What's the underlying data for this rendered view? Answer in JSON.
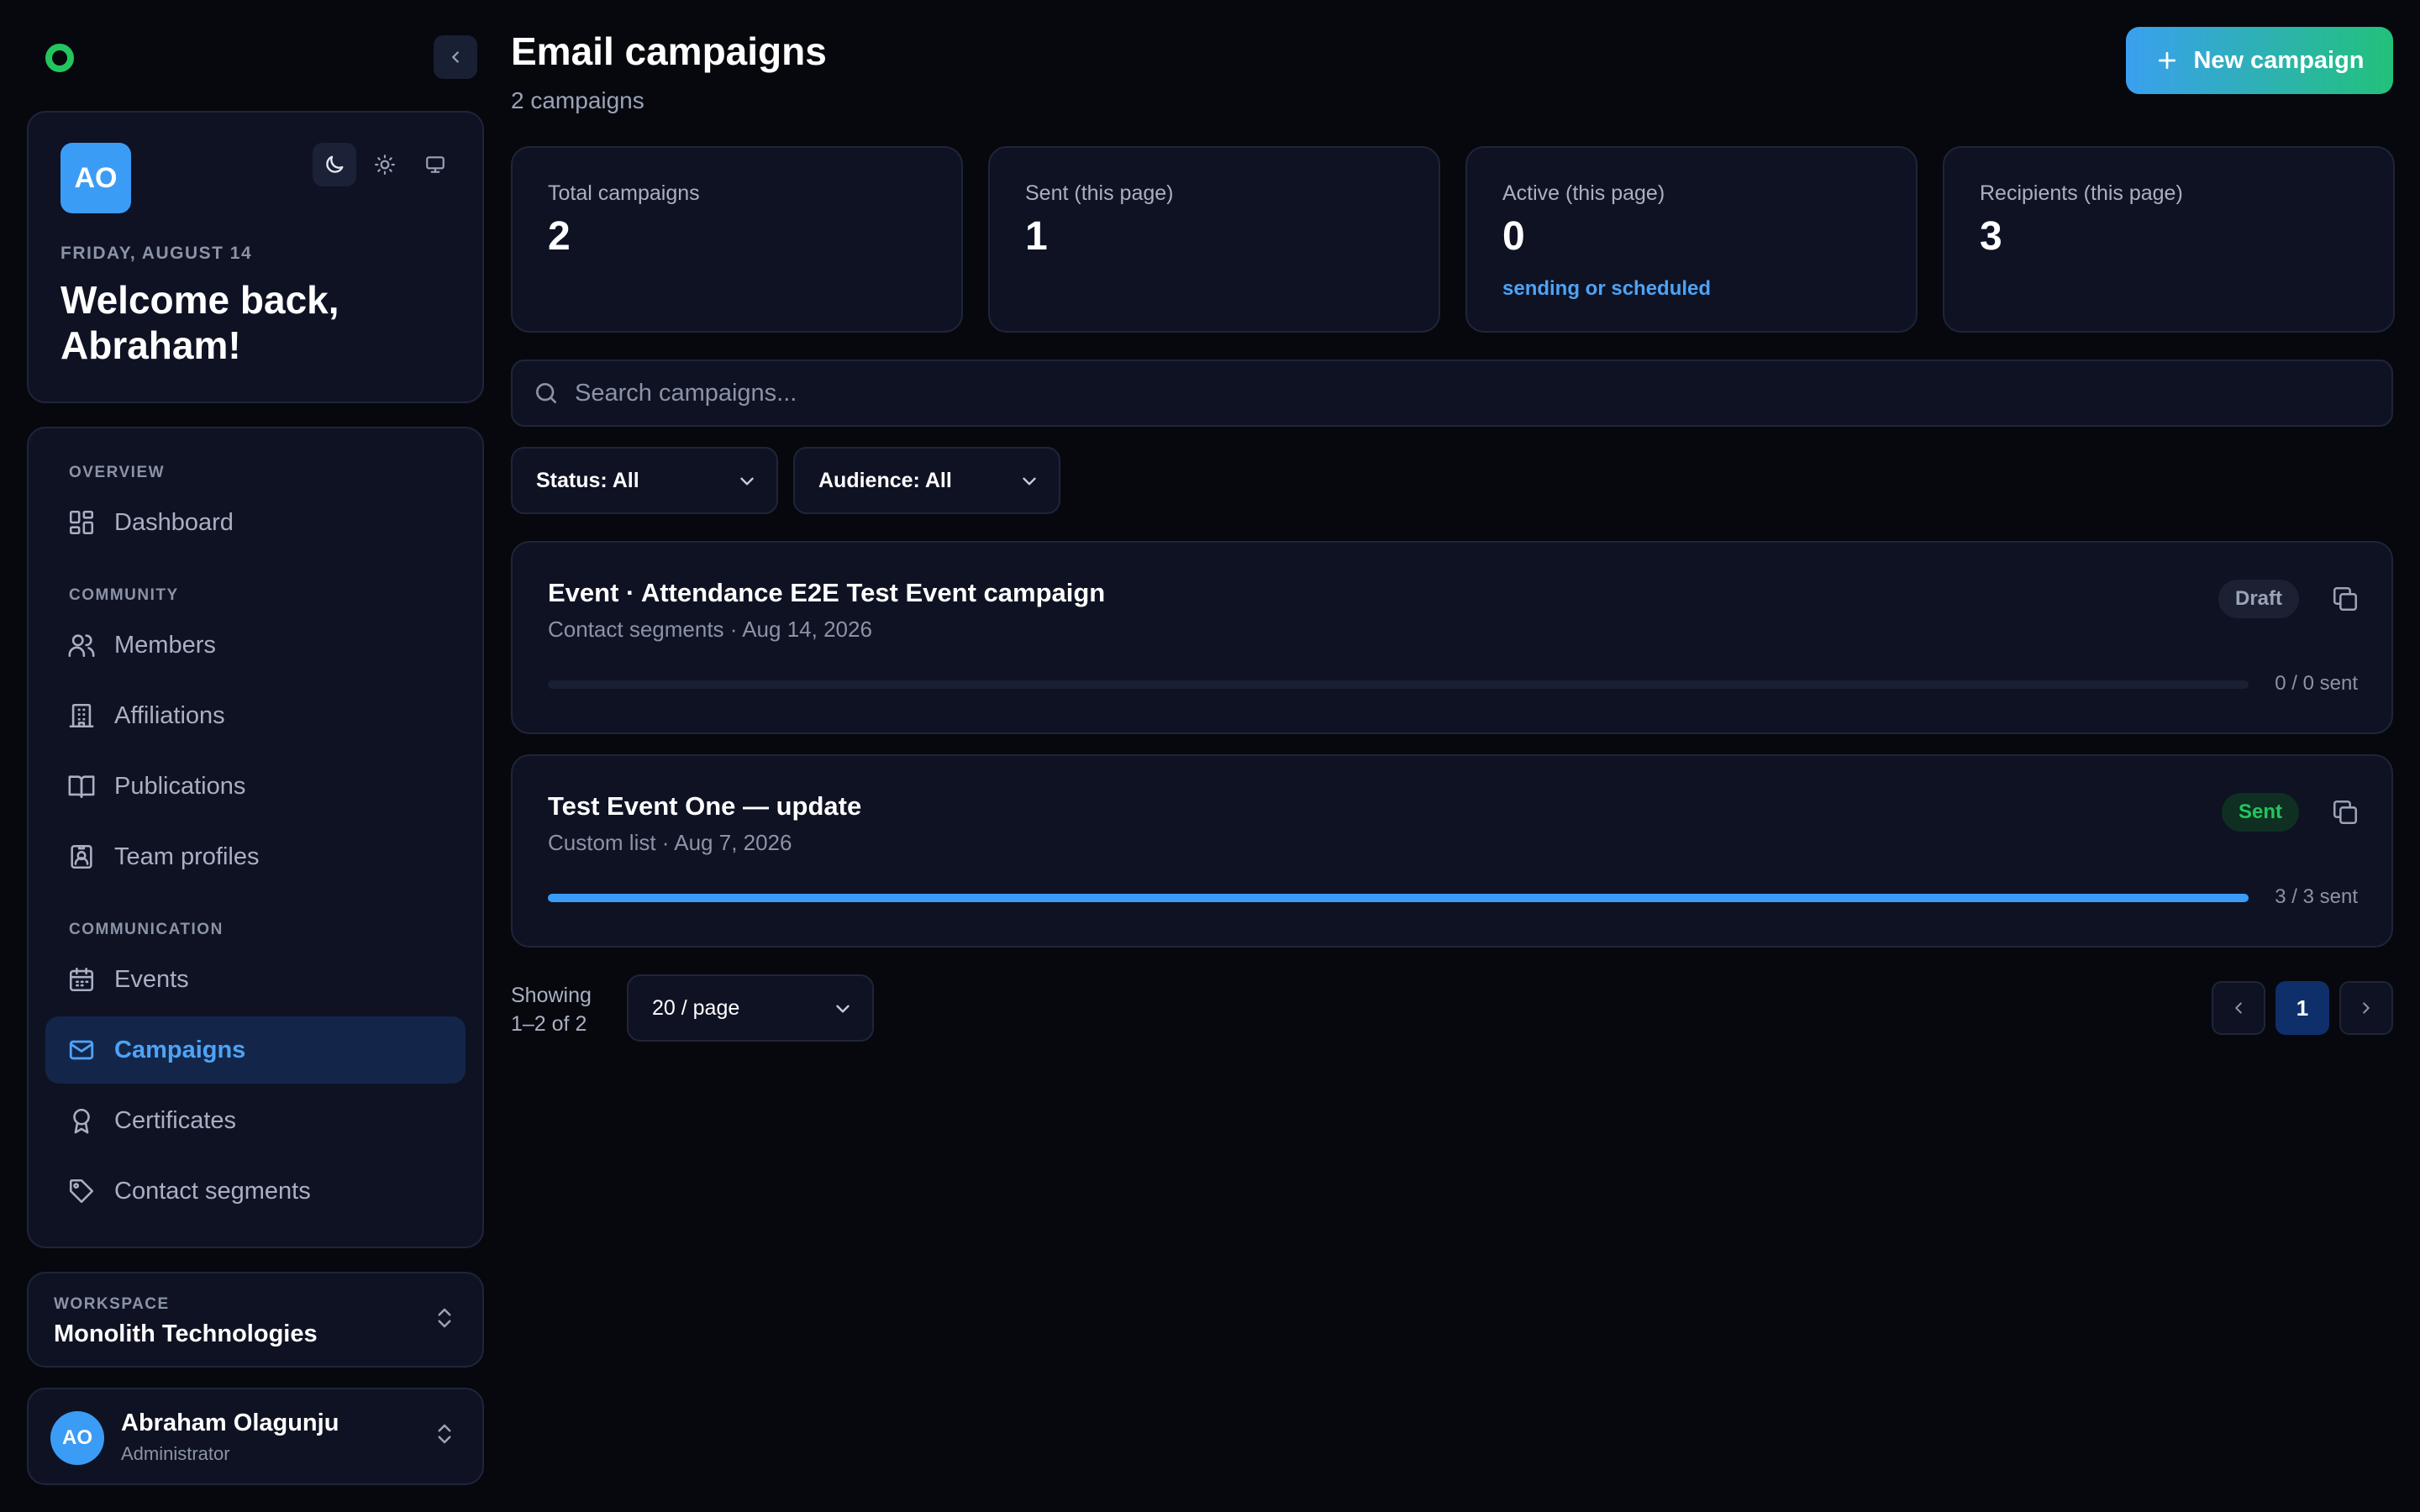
{
  "sidebar": {
    "welcome": {
      "avatar_initials": "AO",
      "date": "FRIDAY, AUGUST 14",
      "title": "Welcome back, Abraham!"
    },
    "sections": {
      "overview": "OVERVIEW",
      "community": "COMMUNITY",
      "communication": "COMMUNICATION"
    },
    "items": {
      "dashboard": "Dashboard",
      "members": "Members",
      "affiliations": "Affiliations",
      "publications": "Publications",
      "team_profiles": "Team profiles",
      "events": "Events",
      "campaigns": "Campaigns",
      "certificates": "Certificates",
      "contact_segments": "Contact segments"
    },
    "workspace": {
      "label": "WORKSPACE",
      "name": "Monolith Technologies"
    },
    "user": {
      "initials": "AO",
      "name": "Abraham Olagunju",
      "role": "Administrator"
    }
  },
  "header": {
    "title": "Email campaigns",
    "subtitle": "2 campaigns",
    "new_button": "New campaign"
  },
  "stats": [
    {
      "label": "Total campaigns",
      "value": "2"
    },
    {
      "label": "Sent (this page)",
      "value": "1"
    },
    {
      "label": "Active (this page)",
      "value": "0",
      "note": "sending or scheduled"
    },
    {
      "label": "Recipients (this page)",
      "value": "3"
    }
  ],
  "search": {
    "placeholder": "Search campaigns...",
    "value": ""
  },
  "filters": {
    "status": "Status: All",
    "audience": "Audience: All"
  },
  "campaigns": [
    {
      "title": "Event · Attendance E2E Test Event campaign",
      "meta": "Contact segments · Aug 14, 2026",
      "status": "Draft",
      "progress": 0,
      "progress_label": "0 / 0 sent"
    },
    {
      "title": "Test Event One — update",
      "meta": "Custom list · Aug 7, 2026",
      "status": "Sent",
      "progress": 1,
      "progress_label": "3 / 3 sent"
    }
  ],
  "pagination": {
    "showing": "Showing 1–2 of 2",
    "page_size": "20 / page",
    "current_page": "1"
  },
  "colors": {
    "accent": "#3b9cf6",
    "success": "#22c55e",
    "background": "#07080e",
    "card": "#0e1223"
  }
}
